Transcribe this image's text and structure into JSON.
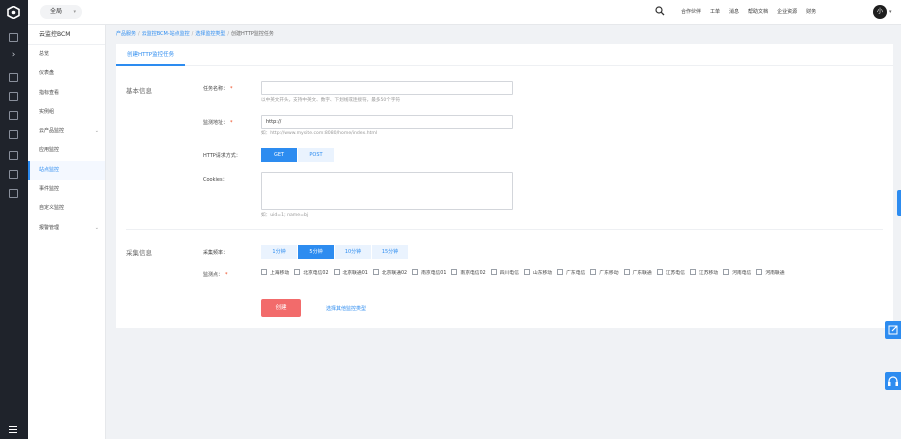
{
  "topbar": {
    "region": "全局",
    "links": [
      "合作伙伴",
      "工单",
      "消息",
      "帮助文档",
      "企业资源",
      "财务"
    ],
    "avatar": "小"
  },
  "sidebar": {
    "title": "云监控BCM",
    "items": [
      {
        "label": "总览",
        "active": false,
        "expand": false
      },
      {
        "label": "仪表盘",
        "active": false,
        "expand": false
      },
      {
        "label": "指标查看",
        "active": false,
        "expand": false
      },
      {
        "label": "实例组",
        "active": false,
        "expand": false
      },
      {
        "label": "云产品监控",
        "active": false,
        "expand": true
      },
      {
        "label": "应用监控",
        "active": false,
        "expand": false
      },
      {
        "label": "站点监控",
        "active": true,
        "expand": false
      },
      {
        "label": "事件监控",
        "active": false,
        "expand": false
      },
      {
        "label": "自定义监控",
        "active": false,
        "expand": false
      },
      {
        "label": "报警管理",
        "active": false,
        "expand": true
      }
    ]
  },
  "breadcrumb": {
    "items": [
      "产品服务",
      "云监控BCM-站点监控",
      "选择监控类型"
    ],
    "current": "创建HTTP监控任务"
  },
  "tab": "创建HTTP监控任务",
  "basic": {
    "title": "基本信息",
    "task_name_label": "任务名称：",
    "task_name_value": "",
    "task_name_hint": "以中英文开头，支持中英文、数字、下划线或连接符，最多50个字符",
    "url_label": "监测地址：",
    "url_value": "http://",
    "url_hint": "如：http://www.mysite.com:8080/home/index.html",
    "method_label": "HTTP请求方式：",
    "methods": [
      {
        "label": "GET",
        "selected": true
      },
      {
        "label": "POST",
        "selected": false
      }
    ],
    "cookies_label": "Cookies：",
    "cookies_hint": "如：uid=1; name=bj"
  },
  "collect": {
    "title": "采集信息",
    "freq_label": "采集频率：",
    "freqs": [
      {
        "label": "1分钟",
        "selected": false
      },
      {
        "label": "5分钟",
        "selected": true
      },
      {
        "label": "10分钟",
        "selected": false
      },
      {
        "label": "15分钟",
        "selected": false
      }
    ],
    "points_label": "监测点：",
    "points": [
      "上海移动",
      "北京电信02",
      "北京联通01",
      "北京联通02",
      "南京电信01",
      "南京电信02",
      "四川电信",
      "山东移动",
      "广东电信",
      "广东移动",
      "广东联通",
      "江苏电信",
      "江苏移动",
      "河南电信",
      "河南联通"
    ]
  },
  "actions": {
    "create": "创建",
    "other": "选择其他监控类型"
  },
  "colors": {
    "accent": "#2d8cf0",
    "create_button": "#f26b6b",
    "rail": "#1f232b"
  }
}
